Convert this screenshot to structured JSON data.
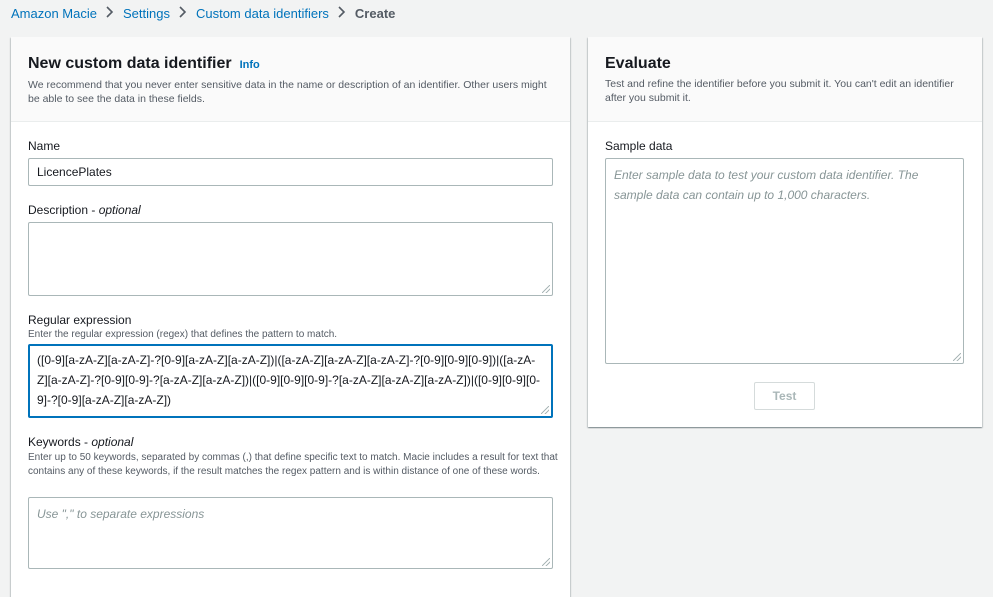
{
  "breadcrumb": {
    "items": [
      "Amazon Macie",
      "Settings",
      "Custom data identifiers"
    ],
    "current": "Create"
  },
  "left_panel": {
    "title": "New custom data identifier",
    "info_label": "Info",
    "description": "We recommend that you never enter sensitive data in the name or description of an identifier. Other users might be able to see the data in these fields.",
    "name_label": "Name",
    "name_value": "LicencePlates",
    "description_label": "Description - ",
    "description_optional": "optional",
    "description_value": "",
    "regex_label": "Regular expression",
    "regex_hint": "Enter the regular expression (regex) that defines the pattern to match.",
    "regex_value": "([0-9][a-zA-Z][a-zA-Z]-?[0-9][a-zA-Z][a-zA-Z])|([a-zA-Z][a-zA-Z][a-zA-Z]-?[0-9][0-9][0-9])|([a-zA-Z][a-zA-Z]-?[0-9][0-9]-?[a-zA-Z][a-zA-Z])|([0-9][0-9][0-9]-?[a-zA-Z][a-zA-Z][a-zA-Z])|([0-9][0-9][0-9]-?[0-9][a-zA-Z][a-zA-Z])",
    "keywords_label": "Keywords - ",
    "keywords_optional": "optional",
    "keywords_hint": "Enter up to 50 keywords, separated by commas (,) that define specific text to match. Macie includes a result for text that contains any of these keywords, if the result matches the regex pattern and is within distance of one of these words.",
    "keywords_placeholder": "Use \",\" to separate expressions"
  },
  "right_panel": {
    "title": "Evaluate",
    "description": "Test and refine the identifier before you submit it. You can't edit an identifier after you submit it.",
    "sample_label": "Sample data",
    "sample_placeholder": "Enter sample data to test your custom data identifier. The sample data can contain up to 1,000 characters.",
    "test_button": "Test"
  },
  "colors": {
    "link": "#0073bb",
    "focus": "#0073bb",
    "background": "#f2f3f3"
  }
}
